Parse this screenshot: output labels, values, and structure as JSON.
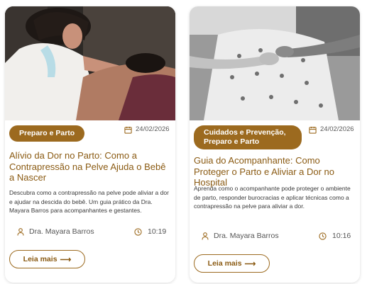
{
  "cards": [
    {
      "image_alt": "Profissional aplicando contrapressão na pelve de gestante",
      "category": "Preparo e Parto",
      "date": "24/02/2026",
      "title": "Alívio da Dor no Parto: Como a Contrapressão na Pelve Ajuda o Bebê a Nascer",
      "description": "Descubra como a contrapressão na pelve pode aliviar a dor e ajudar na descida do bebê. Um guia prático da Dra. Mayara Barros para acompanhantes e gestantes.",
      "author": "Dra. Mayara Barros",
      "read_time": "10:19",
      "button_label": "Leia mais",
      "button_arrow": "⟶"
    },
    {
      "image_alt": "Acompanhantes apoiando gestante no hospital",
      "category": "Cuidados e Prevenção, Preparo e Parto",
      "date": "24/02/2026",
      "title": "Guia do Acompanhante: Como Proteger o Parto e Aliviar a Dor no Hospital",
      "description": "Aprenda como o acompanhante pode proteger o ambiente de parto, responder burocracias e aplicar técnicas como a contrapressão na pelve para aliviar a dor.",
      "author": "Dra. Mayara Barros",
      "read_time": "10:16",
      "button_label": "Leia mais",
      "button_arrow": "⟶"
    }
  ],
  "colors": {
    "accent": "#9c6a1f",
    "title": "#8a5a12",
    "text": "#3a3a3a"
  },
  "icons": {
    "date": "calendar-icon",
    "author": "user-icon",
    "time": "clock-icon",
    "button": "arrow-right-icon"
  }
}
